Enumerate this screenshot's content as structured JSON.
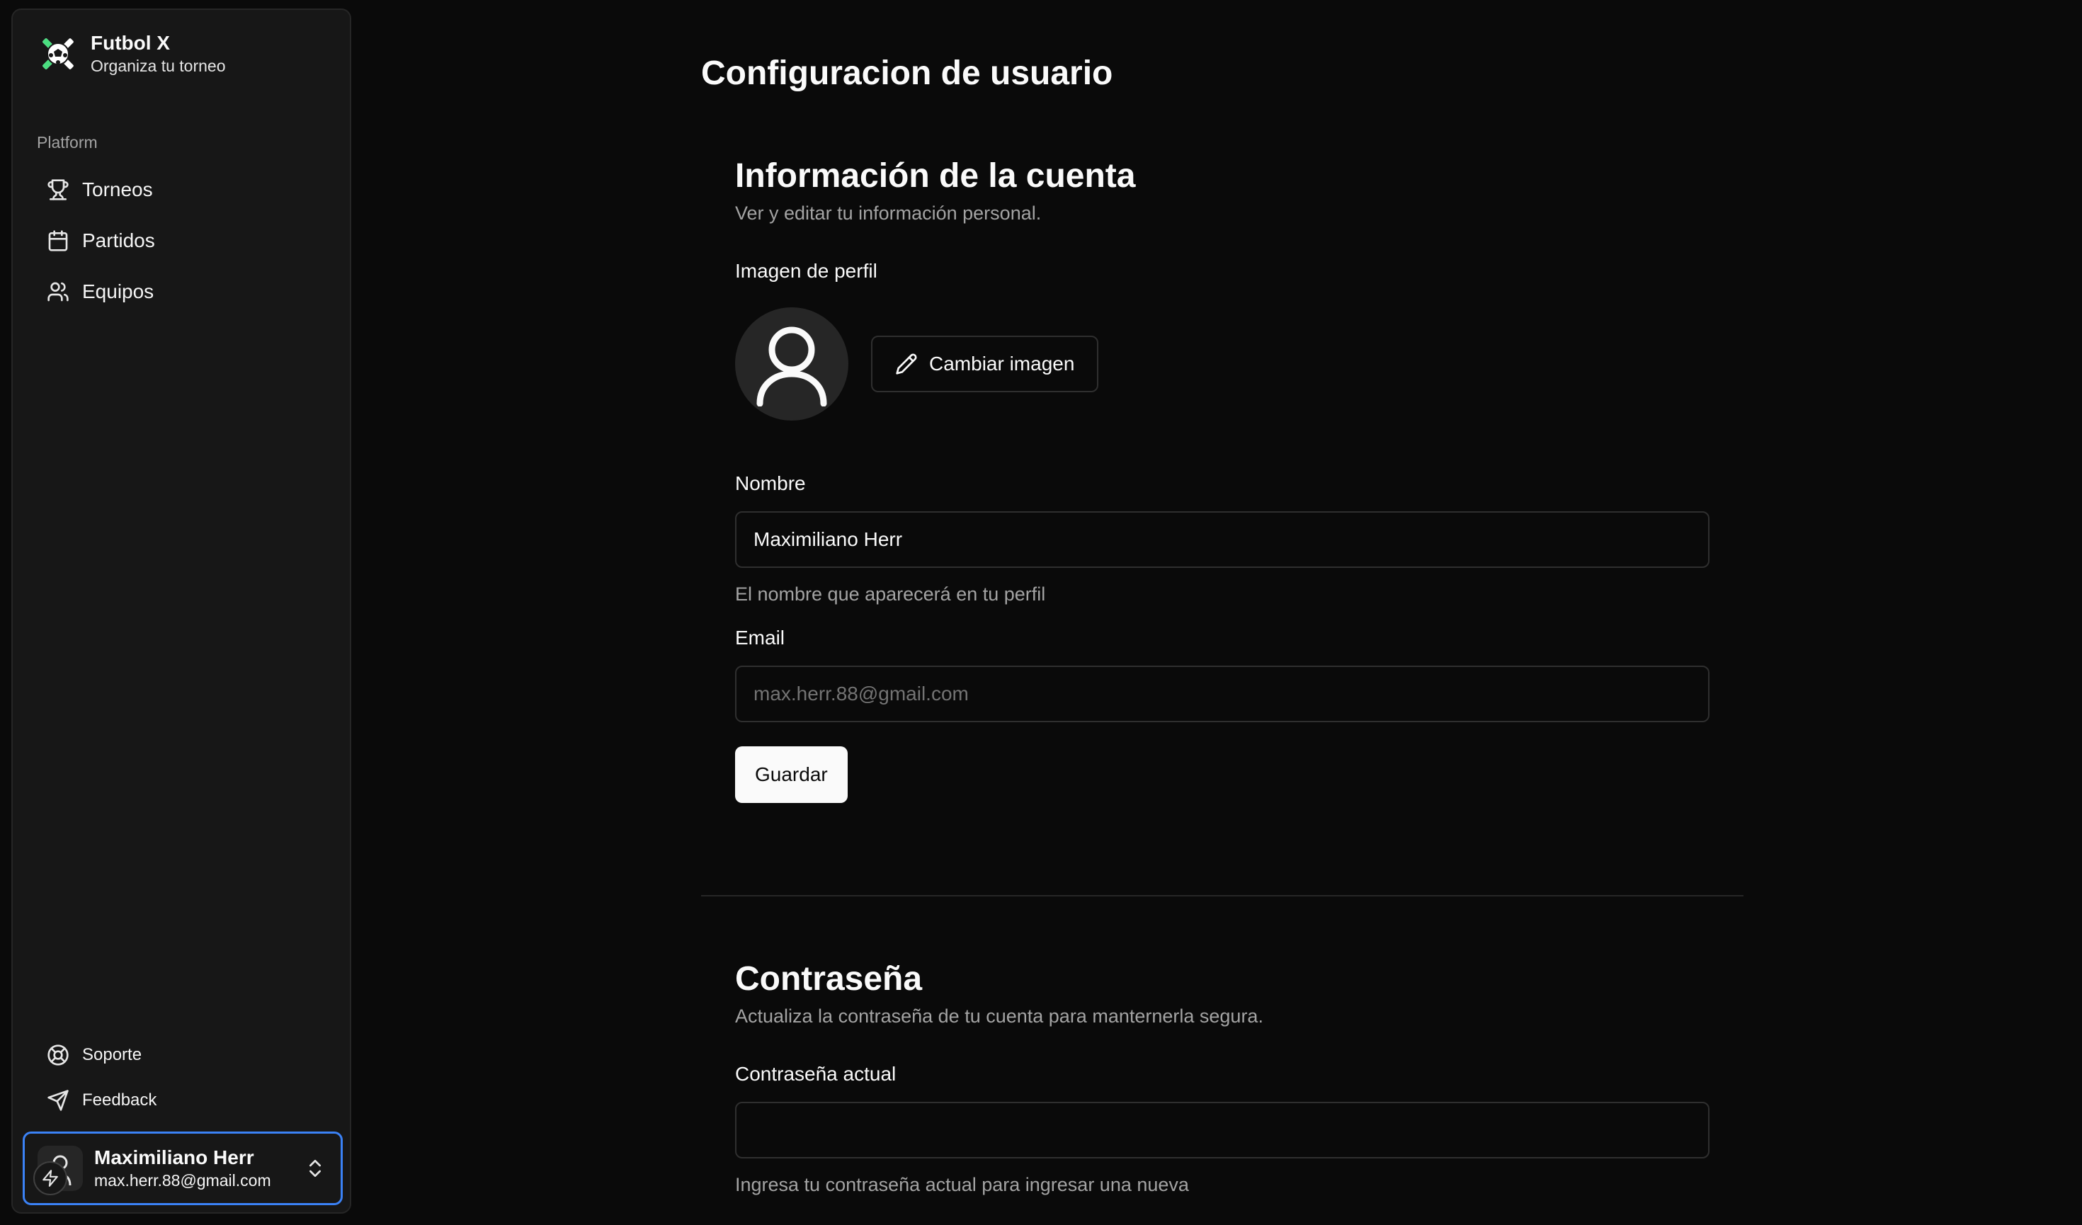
{
  "sidebar": {
    "brand": {
      "name": "Futbol X",
      "tagline": "Organiza tu torneo",
      "logo_icon": "soccer-ball-logo-icon"
    },
    "group_label": "Platform",
    "nav_items": [
      {
        "label": "Torneos",
        "icon": "trophy-icon"
      },
      {
        "label": "Partidos",
        "icon": "calendar-icon"
      },
      {
        "label": "Equipos",
        "icon": "users-icon"
      }
    ],
    "footer_items": [
      {
        "label": "Soporte",
        "icon": "life-buoy-icon"
      },
      {
        "label": "Feedback",
        "icon": "send-icon"
      }
    ],
    "user": {
      "name": "Maximiliano Herr",
      "email": "max.herr.88@gmail.com"
    }
  },
  "main": {
    "page_title": "Configuracion de usuario",
    "account": {
      "title": "Información de la cuenta",
      "description": "Ver y editar tu información personal.",
      "avatar_label": "Imagen de perfil",
      "change_image_label": "Cambiar imagen",
      "name_label": "Nombre",
      "name_value": "Maximiliano Herr",
      "name_help": "El nombre que aparecerá en tu perfil",
      "email_label": "Email",
      "email_placeholder": "max.herr.88@gmail.com",
      "save_label": "Guardar"
    },
    "password": {
      "title": "Contraseña",
      "description": "Actualiza la contraseña de tu cuenta para manternerla segura.",
      "current_label": "Contraseña actual",
      "current_value": "",
      "current_help": "Ingresa tu contraseña actual para ingresar una nueva"
    }
  },
  "colors": {
    "background": "#0a0a0a",
    "sidebar": "#171717",
    "border": "#262626",
    "muted_text": "#a3a3a3",
    "accent_focus": "#3b82f6",
    "primary_button": "#fafafa"
  }
}
